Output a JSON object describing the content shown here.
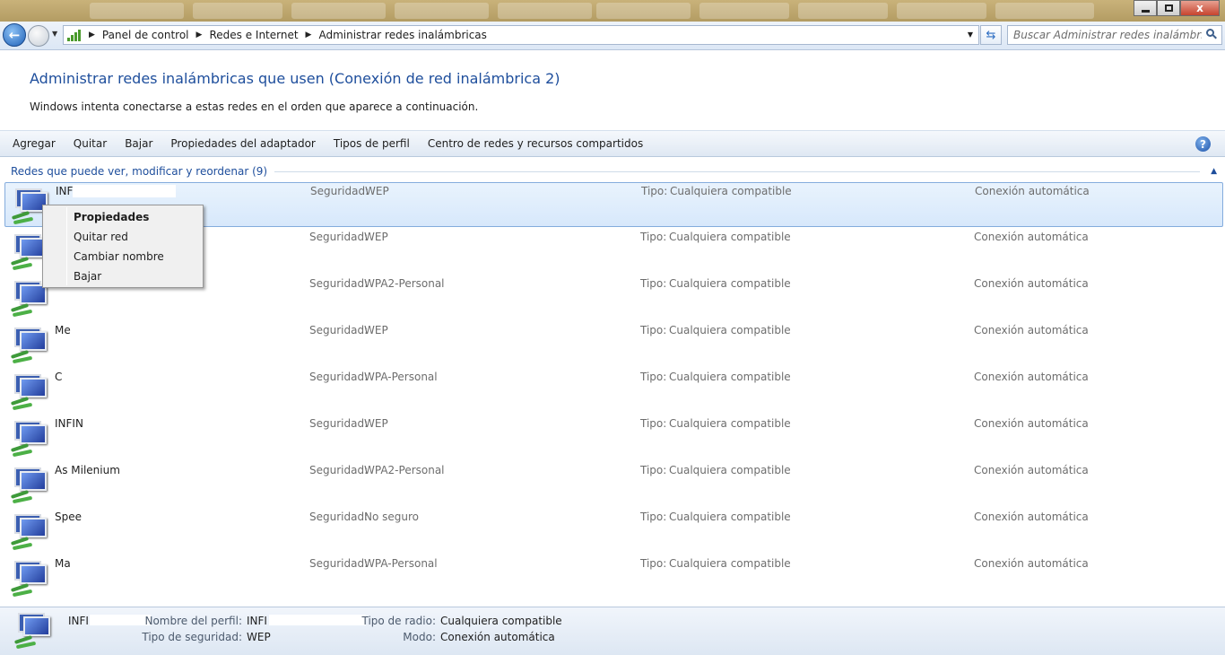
{
  "window": {
    "close_label": "x"
  },
  "address": {
    "crumbs": [
      "Panel de control",
      "Redes e Internet",
      "Administrar redes inalámbricas"
    ],
    "search_placeholder": "Buscar Administrar redes inalámbricas"
  },
  "header": {
    "title": "Administrar redes inalámbricas que usen (Conexión de red inalámbrica 2)",
    "description": "Windows intenta conectarse a estas redes en el orden que aparece a continuación."
  },
  "toolbar": {
    "items": [
      "Agregar",
      "Quitar",
      "Bajar",
      "Propiedades del adaptador",
      "Tipos de perfil",
      "Centro de redes y recursos compartidos"
    ],
    "help": "?"
  },
  "group": {
    "label": "Redes que puede ver, modificar y reordenar (9)"
  },
  "labels": {
    "security": "Seguridad:",
    "type": "Tipo:"
  },
  "networks": [
    {
      "name": "INF",
      "security": "WEP",
      "type": "Cualquiera compatible",
      "mode": "Conexión automática"
    },
    {
      "name": "",
      "security": "WEP",
      "type": "Cualquiera compatible",
      "mode": "Conexión automática"
    },
    {
      "name": "",
      "security": "WPA2-Personal",
      "type": "Cualquiera compatible",
      "mode": "Conexión automática"
    },
    {
      "name": "Me",
      "security": "WEP",
      "type": "Cualquiera compatible",
      "mode": "Conexión automática"
    },
    {
      "name": "C",
      "security": "WPA-Personal",
      "type": "Cualquiera compatible",
      "mode": "Conexión automática"
    },
    {
      "name": "INFIN",
      "security": "WEP",
      "type": "Cualquiera compatible",
      "mode": "Conexión automática"
    },
    {
      "name": "As Milenium",
      "security": "WPA2-Personal",
      "type": "Cualquiera compatible",
      "mode": "Conexión automática"
    },
    {
      "name": "Spee",
      "security": "No seguro",
      "type": "Cualquiera compatible",
      "mode": "Conexión automática"
    },
    {
      "name": "Ma",
      "security": "WPA-Personal",
      "type": "Cualquiera compatible",
      "mode": "Conexión automática"
    }
  ],
  "context_menu": {
    "items": [
      "Propiedades",
      "Quitar red",
      "Cambiar nombre",
      "Bajar"
    ]
  },
  "details": {
    "name": "INFI",
    "profile_label": "Nombre del perfil:",
    "profile_value": "INFI",
    "sec_label": "Tipo de seguridad:",
    "sec_value": "WEP",
    "radio_label": "Tipo de radio:",
    "radio_value": "Cualquiera compatible",
    "mode_label": "Modo:",
    "mode_value": "Conexión automática"
  }
}
